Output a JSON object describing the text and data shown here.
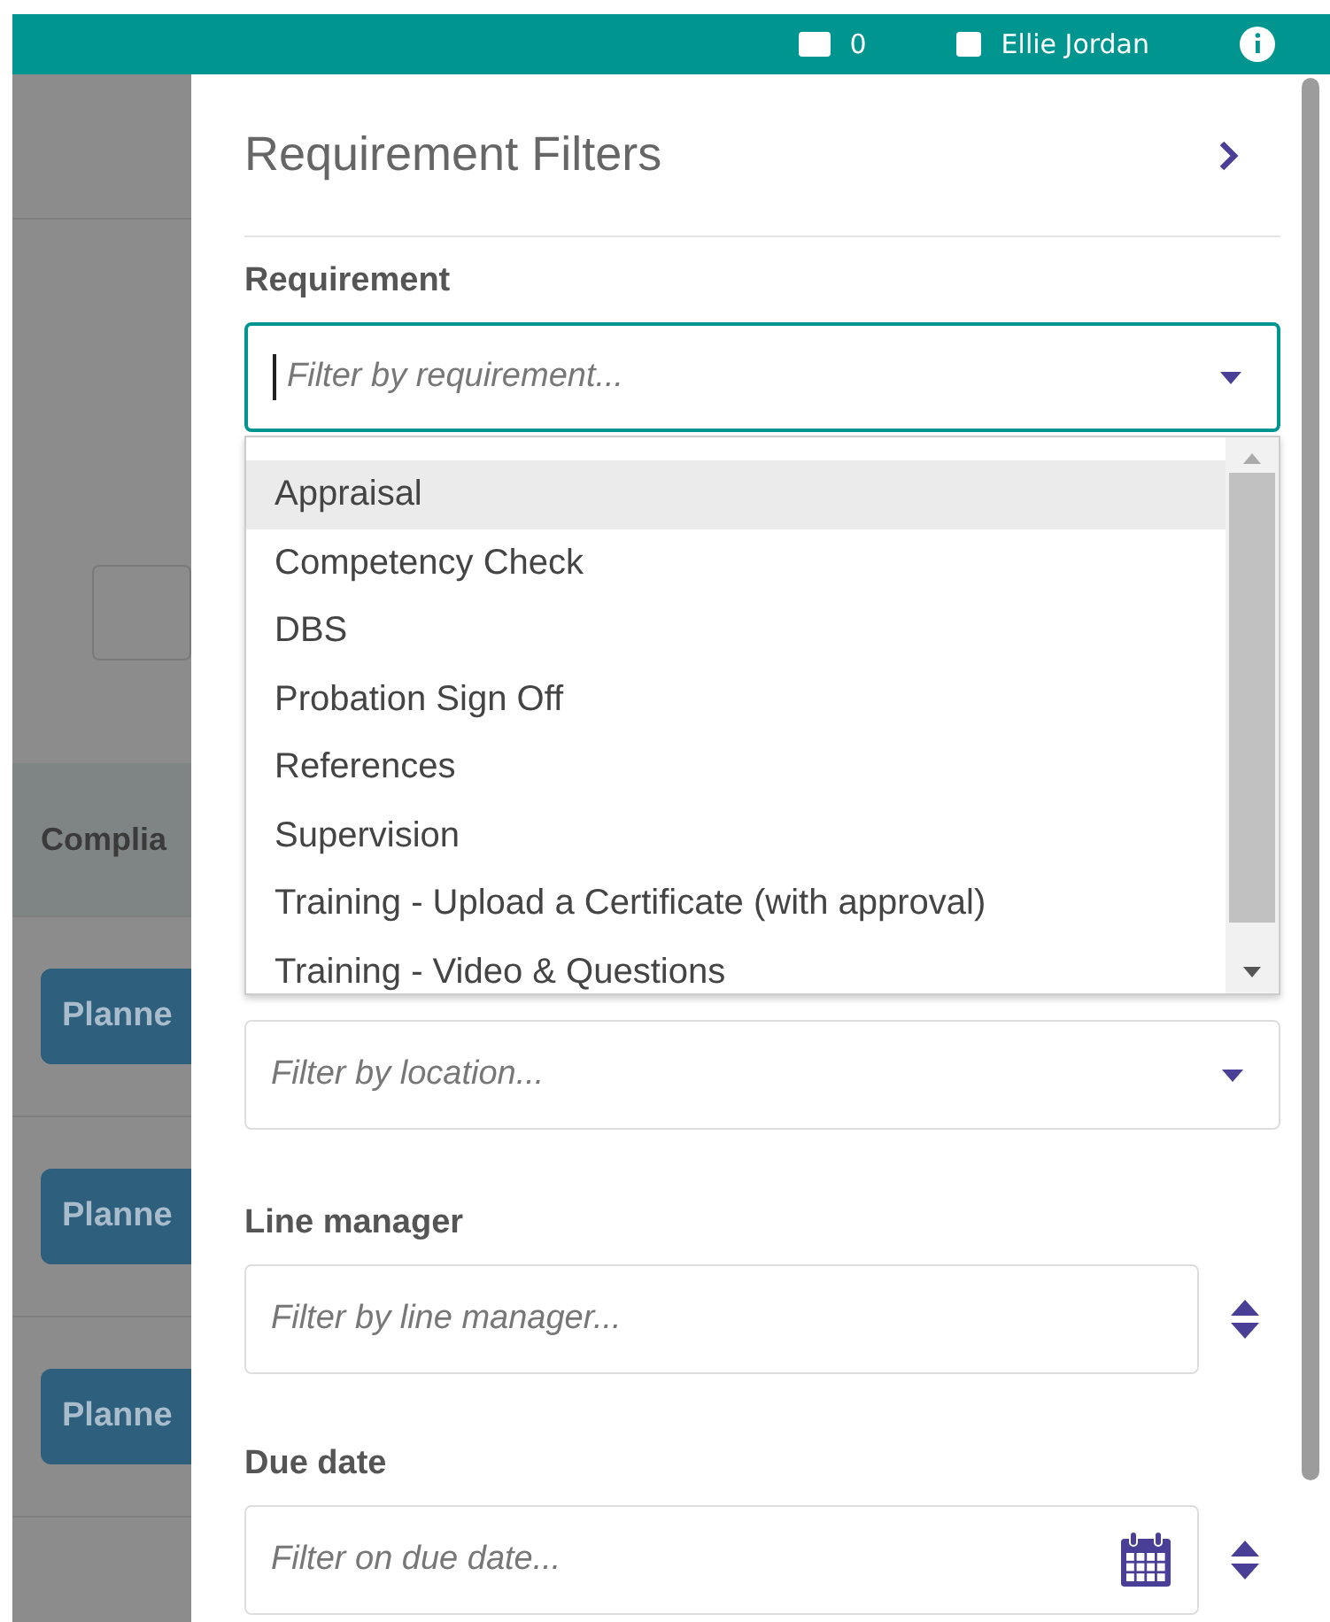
{
  "top_bar": {
    "count": "0",
    "user": "Ellie Jordan"
  },
  "background": {
    "column_header": "Complia",
    "row_buttons": [
      "Planne",
      "Planne",
      "Planne"
    ]
  },
  "panel": {
    "title": "Requirement Filters",
    "filters": [
      {
        "kind": "dropdown",
        "label": "Requirement",
        "placeholder": "Filter by requirement...",
        "focused": true,
        "expanded": true,
        "options": [
          {
            "label": "Appraisal",
            "selected": true
          },
          {
            "label": "Competency Check",
            "selected": false
          },
          {
            "label": "DBS",
            "selected": false
          },
          {
            "label": "Probation Sign Off",
            "selected": false
          },
          {
            "label": "References",
            "selected": false
          },
          {
            "label": "Supervision",
            "selected": false
          },
          {
            "label": "Training - Upload a Certificate (with approval)",
            "selected": false
          },
          {
            "label": "Training - Video & Questions",
            "selected": false
          }
        ]
      },
      {
        "kind": "dropdown",
        "placeholder": "Filter by location...",
        "focused": false
      },
      {
        "kind": "sortable",
        "label": "Line manager",
        "placeholder": "Filter by line manager..."
      },
      {
        "kind": "date",
        "label": "Due date",
        "placeholder": "Filter on due date..."
      }
    ]
  }
}
